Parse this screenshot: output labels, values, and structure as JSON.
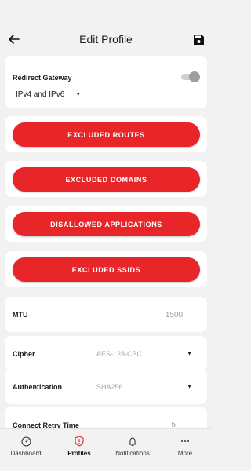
{
  "header": {
    "title": "Edit Profile",
    "back_icon": "arrow-left-icon",
    "save_icon": "save-icon"
  },
  "gateway": {
    "label": "Redirect Gateway",
    "toggle_on": false,
    "selected": "IPv4 and IPv6"
  },
  "buttons": {
    "excluded_routes": "EXCLUDED ROUTES",
    "excluded_domains": "EXCLUDED DOMAINS",
    "disallowed_apps": "DISALLOWED APPLICATIONS",
    "excluded_ssids": "EXCLUDED SSIDS"
  },
  "mtu": {
    "label": "MTU",
    "value": "1500"
  },
  "cipher": {
    "label": "Cipher",
    "value": "AES-128-CBC"
  },
  "auth": {
    "label": "Authentication",
    "value": "SHA256"
  },
  "retry": {
    "label": "Connect Retry Time",
    "value": "5"
  },
  "nav": [
    {
      "label": "Dashboard",
      "icon": "dashboard-icon"
    },
    {
      "label": "Profiles",
      "icon": "shield-icon",
      "active": true
    },
    {
      "label": "Notifications",
      "icon": "bell-icon"
    },
    {
      "label": "More",
      "icon": "more-icon"
    }
  ],
  "colors": {
    "accent": "#e8262a",
    "background": "#f2f2f2",
    "card": "#ffffff"
  }
}
